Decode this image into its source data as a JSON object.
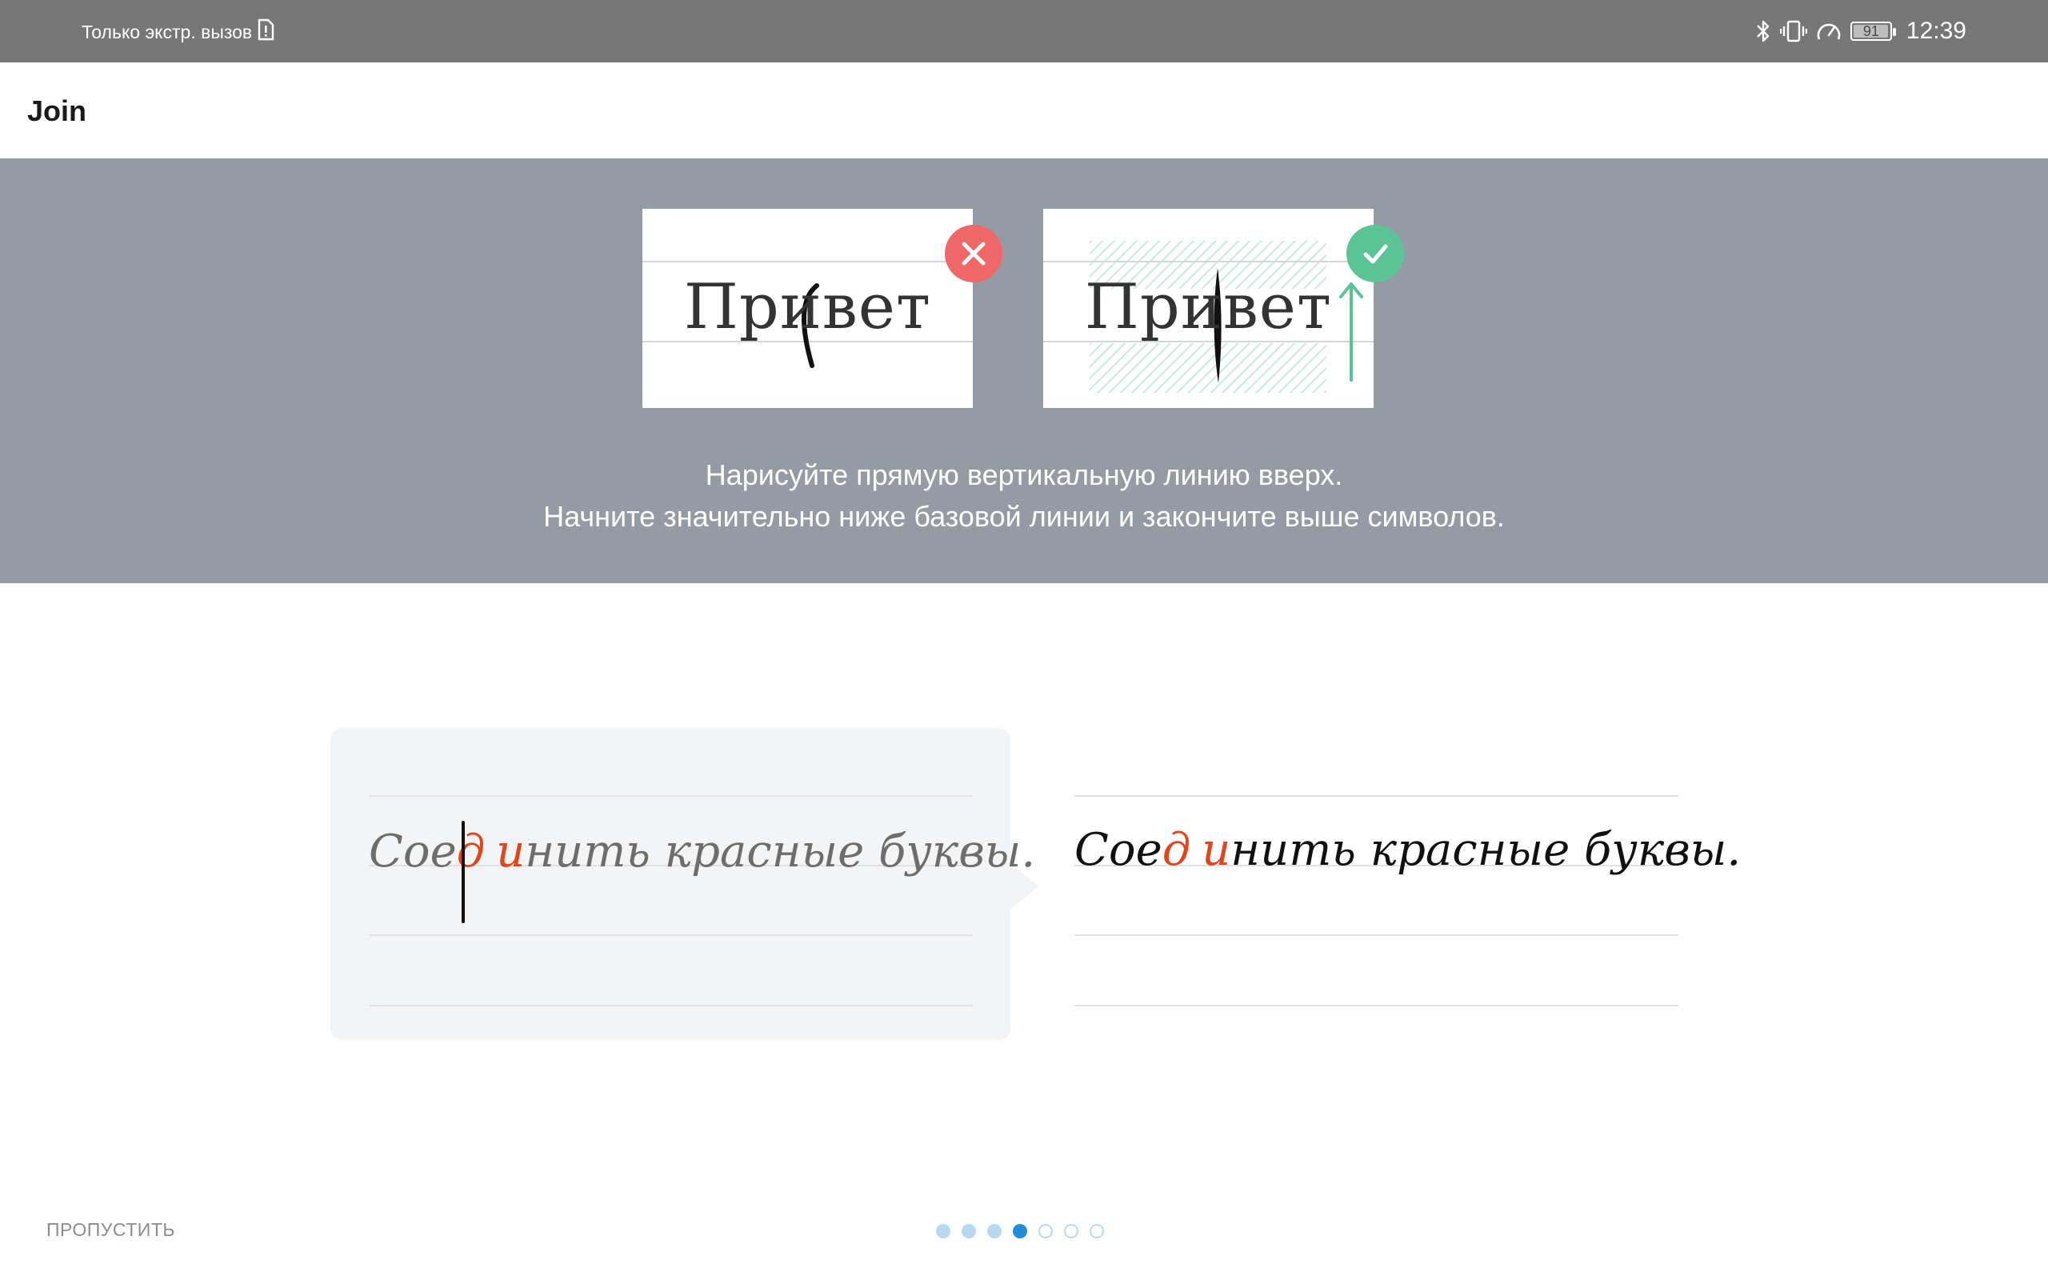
{
  "status_bar": {
    "carrier_text": "Только экстр. вызов",
    "battery_level": "91",
    "time": "12:39",
    "icons": [
      "sim-alert-icon",
      "bluetooth-icon",
      "vibrate-icon",
      "speed-icon",
      "battery-icon"
    ]
  },
  "app_bar": {
    "title": "Join"
  },
  "hero": {
    "wrong_example": {
      "word": "Привет",
      "icon": "close-icon"
    },
    "right_example": {
      "word": "Привет",
      "icon": "check-icon"
    },
    "instruction_line1": "Нарисуйте прямую вертикальную линию вверх.",
    "instruction_line2": "Начните значительно ниже базовой линии и закончите выше символов."
  },
  "demo": {
    "before": {
      "part1": "Сое",
      "red1": "д",
      "red2": "и",
      "part2": "нить красные буквы."
    },
    "after": {
      "part1": "Сое",
      "red1": "д",
      "red2": "и",
      "part2": "нить красные буквы."
    }
  },
  "footer": {
    "skip_label": "ПРОПУСТИТЬ",
    "pager": {
      "total": 7,
      "current": 4
    }
  },
  "colors": {
    "status_bar": "#777777",
    "hero_bg": "#959ba4",
    "wrong_badge": "#ef6766",
    "right_badge": "#5bc497",
    "highlight_letters": "#e3451b",
    "pager_active": "#1f8cd8"
  }
}
